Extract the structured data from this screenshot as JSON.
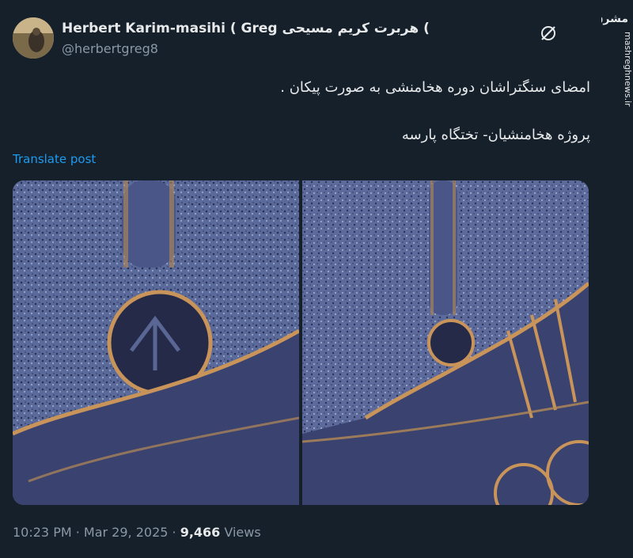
{
  "author": {
    "name": "Herbert Karim-masihi ( Greg هربرت کریم مسیحی (",
    "handle": "@herbertgreg8"
  },
  "post": {
    "line1": "امضای سنگتراشان دوره هخامنشی به صورت پیکان .",
    "line2": "پروژه هخامنشیان- تختگاه پارسه",
    "translate_label": "Translate post"
  },
  "meta": {
    "time": "10:23 PM · Mar 29, 2025 · ",
    "views_count": "9,466",
    "views_label": " Views"
  },
  "watermark": {
    "logo_text": "مشرق",
    "url": "mashreghnews.ir"
  },
  "icons": {
    "grok": "grok-icon"
  },
  "colors": {
    "background": "#15202b",
    "link": "#1d9bf0",
    "secondary_text": "#8b98a5"
  }
}
